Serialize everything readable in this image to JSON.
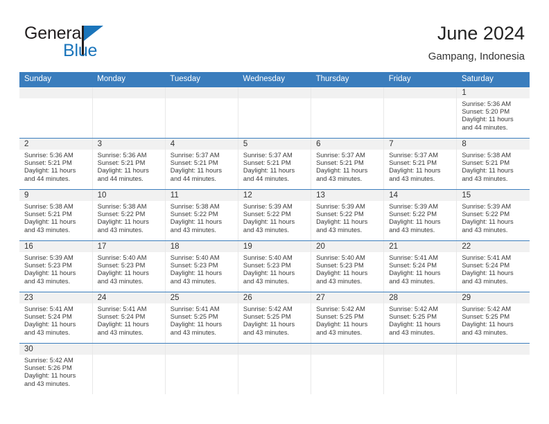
{
  "brand": {
    "name_part1": "General",
    "name_part2": "Blue",
    "logo_icon": "triangle-logo-icon",
    "color_dark": "#231f20",
    "color_blue": "#1b75bb"
  },
  "header": {
    "title": "June 2024",
    "subtitle": "Gampang, Indonesia"
  },
  "theme": {
    "header_band": "#3a7dbd",
    "daynum_band": "#f1f1f1",
    "row_divider": "#3a7dbd",
    "text": "#3a3a3a"
  },
  "calendar": {
    "weekday_headers": [
      "Sunday",
      "Monday",
      "Tuesday",
      "Wednesday",
      "Thursday",
      "Friday",
      "Saturday"
    ],
    "labels": {
      "sunrise": "Sunrise:",
      "sunset": "Sunset:",
      "daylight": "Daylight:"
    },
    "weeks": [
      [
        {
          "empty": true
        },
        {
          "empty": true
        },
        {
          "empty": true
        },
        {
          "empty": true
        },
        {
          "empty": true
        },
        {
          "empty": true
        },
        {
          "day": "1",
          "sunrise": "Sunrise: 5:36 AM",
          "sunset": "Sunset: 5:20 PM",
          "daylight_line1": "Daylight: 11 hours",
          "daylight_line2": "and 44 minutes."
        }
      ],
      [
        {
          "day": "2",
          "sunrise": "Sunrise: 5:36 AM",
          "sunset": "Sunset: 5:21 PM",
          "daylight_line1": "Daylight: 11 hours",
          "daylight_line2": "and 44 minutes."
        },
        {
          "day": "3",
          "sunrise": "Sunrise: 5:36 AM",
          "sunset": "Sunset: 5:21 PM",
          "daylight_line1": "Daylight: 11 hours",
          "daylight_line2": "and 44 minutes."
        },
        {
          "day": "4",
          "sunrise": "Sunrise: 5:37 AM",
          "sunset": "Sunset: 5:21 PM",
          "daylight_line1": "Daylight: 11 hours",
          "daylight_line2": "and 44 minutes."
        },
        {
          "day": "5",
          "sunrise": "Sunrise: 5:37 AM",
          "sunset": "Sunset: 5:21 PM",
          "daylight_line1": "Daylight: 11 hours",
          "daylight_line2": "and 44 minutes."
        },
        {
          "day": "6",
          "sunrise": "Sunrise: 5:37 AM",
          "sunset": "Sunset: 5:21 PM",
          "daylight_line1": "Daylight: 11 hours",
          "daylight_line2": "and 43 minutes."
        },
        {
          "day": "7",
          "sunrise": "Sunrise: 5:37 AM",
          "sunset": "Sunset: 5:21 PM",
          "daylight_line1": "Daylight: 11 hours",
          "daylight_line2": "and 43 minutes."
        },
        {
          "day": "8",
          "sunrise": "Sunrise: 5:38 AM",
          "sunset": "Sunset: 5:21 PM",
          "daylight_line1": "Daylight: 11 hours",
          "daylight_line2": "and 43 minutes."
        }
      ],
      [
        {
          "day": "9",
          "sunrise": "Sunrise: 5:38 AM",
          "sunset": "Sunset: 5:21 PM",
          "daylight_line1": "Daylight: 11 hours",
          "daylight_line2": "and 43 minutes."
        },
        {
          "day": "10",
          "sunrise": "Sunrise: 5:38 AM",
          "sunset": "Sunset: 5:22 PM",
          "daylight_line1": "Daylight: 11 hours",
          "daylight_line2": "and 43 minutes."
        },
        {
          "day": "11",
          "sunrise": "Sunrise: 5:38 AM",
          "sunset": "Sunset: 5:22 PM",
          "daylight_line1": "Daylight: 11 hours",
          "daylight_line2": "and 43 minutes."
        },
        {
          "day": "12",
          "sunrise": "Sunrise: 5:39 AM",
          "sunset": "Sunset: 5:22 PM",
          "daylight_line1": "Daylight: 11 hours",
          "daylight_line2": "and 43 minutes."
        },
        {
          "day": "13",
          "sunrise": "Sunrise: 5:39 AM",
          "sunset": "Sunset: 5:22 PM",
          "daylight_line1": "Daylight: 11 hours",
          "daylight_line2": "and 43 minutes."
        },
        {
          "day": "14",
          "sunrise": "Sunrise: 5:39 AM",
          "sunset": "Sunset: 5:22 PM",
          "daylight_line1": "Daylight: 11 hours",
          "daylight_line2": "and 43 minutes."
        },
        {
          "day": "15",
          "sunrise": "Sunrise: 5:39 AM",
          "sunset": "Sunset: 5:22 PM",
          "daylight_line1": "Daylight: 11 hours",
          "daylight_line2": "and 43 minutes."
        }
      ],
      [
        {
          "day": "16",
          "sunrise": "Sunrise: 5:39 AM",
          "sunset": "Sunset: 5:23 PM",
          "daylight_line1": "Daylight: 11 hours",
          "daylight_line2": "and 43 minutes."
        },
        {
          "day": "17",
          "sunrise": "Sunrise: 5:40 AM",
          "sunset": "Sunset: 5:23 PM",
          "daylight_line1": "Daylight: 11 hours",
          "daylight_line2": "and 43 minutes."
        },
        {
          "day": "18",
          "sunrise": "Sunrise: 5:40 AM",
          "sunset": "Sunset: 5:23 PM",
          "daylight_line1": "Daylight: 11 hours",
          "daylight_line2": "and 43 minutes."
        },
        {
          "day": "19",
          "sunrise": "Sunrise: 5:40 AM",
          "sunset": "Sunset: 5:23 PM",
          "daylight_line1": "Daylight: 11 hours",
          "daylight_line2": "and 43 minutes."
        },
        {
          "day": "20",
          "sunrise": "Sunrise: 5:40 AM",
          "sunset": "Sunset: 5:23 PM",
          "daylight_line1": "Daylight: 11 hours",
          "daylight_line2": "and 43 minutes."
        },
        {
          "day": "21",
          "sunrise": "Sunrise: 5:41 AM",
          "sunset": "Sunset: 5:24 PM",
          "daylight_line1": "Daylight: 11 hours",
          "daylight_line2": "and 43 minutes."
        },
        {
          "day": "22",
          "sunrise": "Sunrise: 5:41 AM",
          "sunset": "Sunset: 5:24 PM",
          "daylight_line1": "Daylight: 11 hours",
          "daylight_line2": "and 43 minutes."
        }
      ],
      [
        {
          "day": "23",
          "sunrise": "Sunrise: 5:41 AM",
          "sunset": "Sunset: 5:24 PM",
          "daylight_line1": "Daylight: 11 hours",
          "daylight_line2": "and 43 minutes."
        },
        {
          "day": "24",
          "sunrise": "Sunrise: 5:41 AM",
          "sunset": "Sunset: 5:24 PM",
          "daylight_line1": "Daylight: 11 hours",
          "daylight_line2": "and 43 minutes."
        },
        {
          "day": "25",
          "sunrise": "Sunrise: 5:41 AM",
          "sunset": "Sunset: 5:25 PM",
          "daylight_line1": "Daylight: 11 hours",
          "daylight_line2": "and 43 minutes."
        },
        {
          "day": "26",
          "sunrise": "Sunrise: 5:42 AM",
          "sunset": "Sunset: 5:25 PM",
          "daylight_line1": "Daylight: 11 hours",
          "daylight_line2": "and 43 minutes."
        },
        {
          "day": "27",
          "sunrise": "Sunrise: 5:42 AM",
          "sunset": "Sunset: 5:25 PM",
          "daylight_line1": "Daylight: 11 hours",
          "daylight_line2": "and 43 minutes."
        },
        {
          "day": "28",
          "sunrise": "Sunrise: 5:42 AM",
          "sunset": "Sunset: 5:25 PM",
          "daylight_line1": "Daylight: 11 hours",
          "daylight_line2": "and 43 minutes."
        },
        {
          "day": "29",
          "sunrise": "Sunrise: 5:42 AM",
          "sunset": "Sunset: 5:25 PM",
          "daylight_line1": "Daylight: 11 hours",
          "daylight_line2": "and 43 minutes."
        }
      ],
      [
        {
          "day": "30",
          "sunrise": "Sunrise: 5:42 AM",
          "sunset": "Sunset: 5:26 PM",
          "daylight_line1": "Daylight: 11 hours",
          "daylight_line2": "and 43 minutes."
        },
        {
          "empty": true
        },
        {
          "empty": true
        },
        {
          "empty": true
        },
        {
          "empty": true
        },
        {
          "empty": true
        },
        {
          "empty": true
        }
      ]
    ]
  }
}
